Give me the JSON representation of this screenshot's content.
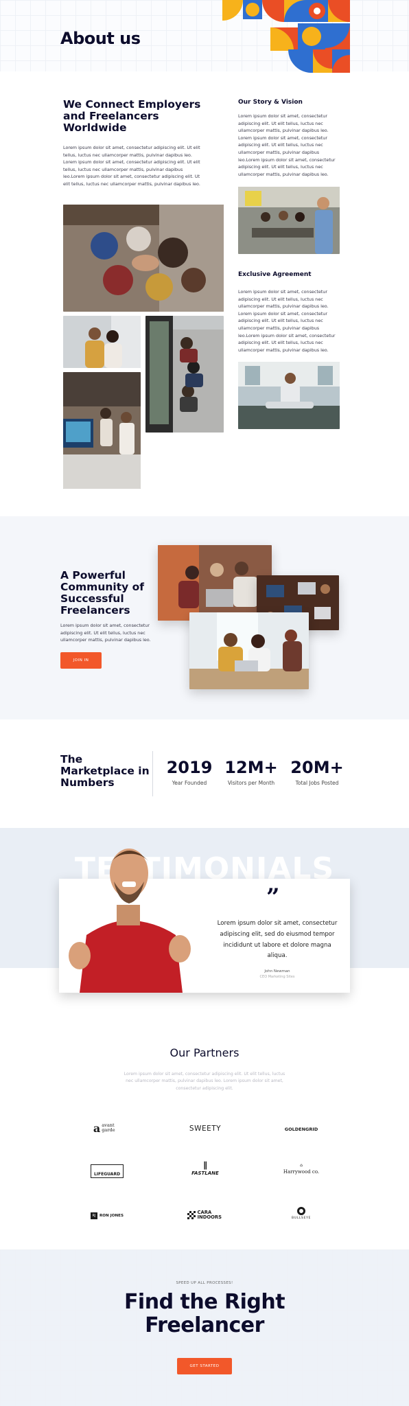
{
  "about": {
    "title": "About us",
    "connect_heading": "We Connect Employers and Freelancers Worldwide",
    "connect_body": "Lorem ipsum dolor sit amet, consectetur adipiscing elit. Ut elit tellus, luctus nec ullamcorper mattis, pulvinar dapibus leo. Lorem ipsum dolor sit amet, consectetur adipiscing elit. Ut elit tellus, luctus nec ullamcorper mattis, pulvinar dapibus leo.Lorem ipsum dolor sit amet, consectetur adipiscing elit. Ut elit tellus, luctus nec ullamcorper mattis, pulvinar dapibus leo.",
    "story_heading": "Our Story & Vision",
    "story_body": "Lorem ipsum dolor sit amet, consectetur adipiscing elit. Ut elit tellus, luctus nec ullamcorper mattis, pulvinar dapibus leo. Lorem ipsum dolor sit amet, consectetur adipiscing elit. Ut elit tellus, luctus nec ullamcorper mattis, pulvinar dapibus leo.Lorem ipsum dolor sit amet, consectetur adipiscing elit. Ut elit tellus, luctus nec ullamcorper mattis, pulvinar dapibus leo.",
    "agreement_heading": "Exclusive Agreement",
    "agreement_body": "Lorem ipsum dolor sit amet, consectetur adipiscing elit. Ut elit tellus, luctus nec ullamcorper mattis, pulvinar dapibus leo. Lorem ipsum dolor sit amet, consectetur adipiscing elit. Ut elit tellus, luctus nec ullamcorper mattis, pulvinar dapibus leo.Lorem ipsum dolor sit amet, consectetur adipiscing elit. Ut elit tellus, luctus nec ullamcorper mattis, pulvinar dapibus leo."
  },
  "community": {
    "heading": "A Powerful Community of Successful Freelancers",
    "body": "Lorem ipsum dolor sit amet, consectetur adipiscing elit. Ut elit tellus, luctus nec ullamcorper mattis, pulvinar dapibus leo.",
    "button": "JOIN IN"
  },
  "numbers": {
    "heading": "The Marketplace in Numbers",
    "stats": [
      {
        "value": "2019",
        "label": "Year Founded"
      },
      {
        "value": "12M+",
        "label": "Visitors per Month"
      },
      {
        "value": "20M+",
        "label": "Total Jobs Posted"
      }
    ]
  },
  "testimonial": {
    "bg_word": "TESTIMONIALS",
    "quote_mark": "”",
    "quote": "Lorem ipsum dolor sit amet, consectetur adipiscing elit, sed do eiusmod tempor incididunt ut labore et dolore magna aliqua.",
    "author": "John Newman",
    "role": "CEO Marketing Sites"
  },
  "partners": {
    "heading": "Our Partners",
    "body": "Lorem ipsum dolor sit amet, consectetur adipiscing elit. Ut elit tellus, luctus nec ullamcorper mattis, pulvinar dapibus leo. Lorem ipsum dolor sit amet, consectetur adipiscing elit.",
    "logos": [
      "avant garde",
      "SWEETY",
      "GOLDENGRID",
      "LIFEGUARD",
      "FASTLANE",
      "Harrywood co.",
      "RON JONES",
      "CARA INDOORS",
      "BULLSEYE"
    ]
  },
  "cta": {
    "eyebrow": "SPEED UP ALL PROCESSES!",
    "heading_line1": "Find the Right",
    "heading_line2": "Freelancer",
    "button": "GET STARTED"
  },
  "colors": {
    "accent": "#f2582a",
    "navy": "#0c0c2c",
    "pattern_blue": "#2f6fd0",
    "pattern_yellow": "#f7b21b",
    "pattern_red": "#ea4e25"
  }
}
